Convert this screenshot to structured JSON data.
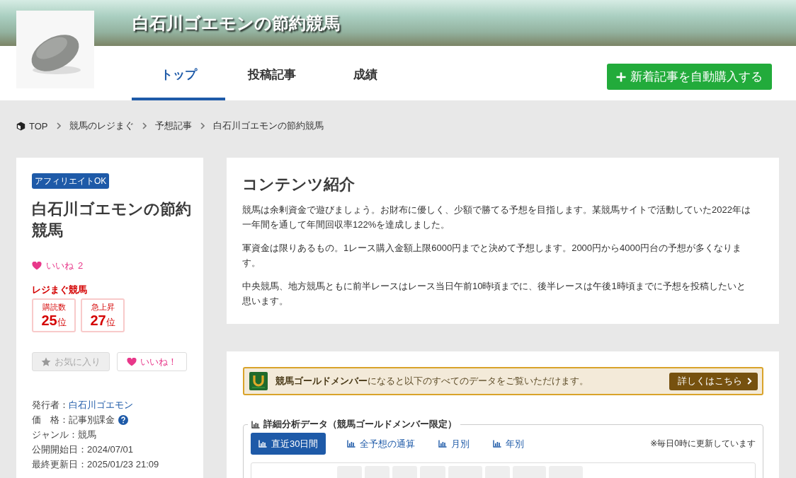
{
  "header": {
    "site_title": "白石川ゴエモンの節約競馬",
    "tabs": [
      {
        "label": "トップ",
        "selected": true
      },
      {
        "label": "投稿記事",
        "selected": false
      },
      {
        "label": "成績",
        "selected": false
      }
    ],
    "cta_button": "新着記事を自動購入する"
  },
  "breadcrumb": [
    "TOP",
    "競馬のレジまぐ",
    "予想記事",
    "白石川ゴエモンの節約競馬"
  ],
  "sidebar": {
    "badge": "アフィリエイトOK",
    "title": "白石川ゴエモンの節約競馬",
    "likes": {
      "label": "いいね",
      "count": "2"
    },
    "ranking": {
      "title": "レジまぐ競馬",
      "items": [
        {
          "label": "購読数",
          "rank": "25",
          "unit": "位"
        },
        {
          "label": "急上昇",
          "rank": "27",
          "unit": "位"
        }
      ]
    },
    "buttons": [
      {
        "kind": "favorite",
        "label": "お気に入り",
        "disabled": true
      },
      {
        "kind": "like",
        "label": "いいね！",
        "disabled": false
      }
    ],
    "info": [
      {
        "kind": "link",
        "label": "発行者：",
        "value": "白石川ゴエモン"
      },
      {
        "kind": "help",
        "label": "価　格：",
        "value": "記事別課金"
      },
      {
        "kind": "text",
        "label": "ジャンル：",
        "value": "競馬"
      },
      {
        "kind": "text",
        "label": "公開開始日：",
        "value": "2024/07/01"
      },
      {
        "kind": "text",
        "label": "最終更新日：",
        "value": "2025/01/23 21:09"
      }
    ]
  },
  "intro": {
    "heading": "コンテンツ紹介",
    "paragraphs": [
      "競馬は余剰資金で遊びましょう。お財布に優しく、少額で勝てる予想を目指します。某競馬サイトで活動していた2022年は一年間を通して年間回収率122%を達成しました。",
      "軍資金は限りあるもの。1レース購入金額上限6000円までと決めて予想します。2000円から4000円台の予想が多くなります。",
      "中央競馬、地方競馬ともに前半レースはレース当日午前10時頃までに、後半レースは午後1時頃までに予想を投稿したいと思います。"
    ]
  },
  "analysis": {
    "banner": {
      "text": "**競馬ゴールドメンバー**になると以下のすべてのデータをご覧いただけます。",
      "button": "詳しくはこちら"
    },
    "section": {
      "legend": "詳細分析データ（競馬ゴールドメンバー限定）",
      "tabs": [
        {
          "label": "直近30日間",
          "selected": true
        },
        {
          "label": "全予想の通算",
          "selected": false
        },
        {
          "label": "月別",
          "selected": false
        },
        {
          "label": "年別",
          "selected": false
        }
      ],
      "note": "※毎日0時に更新しています"
    }
  }
}
